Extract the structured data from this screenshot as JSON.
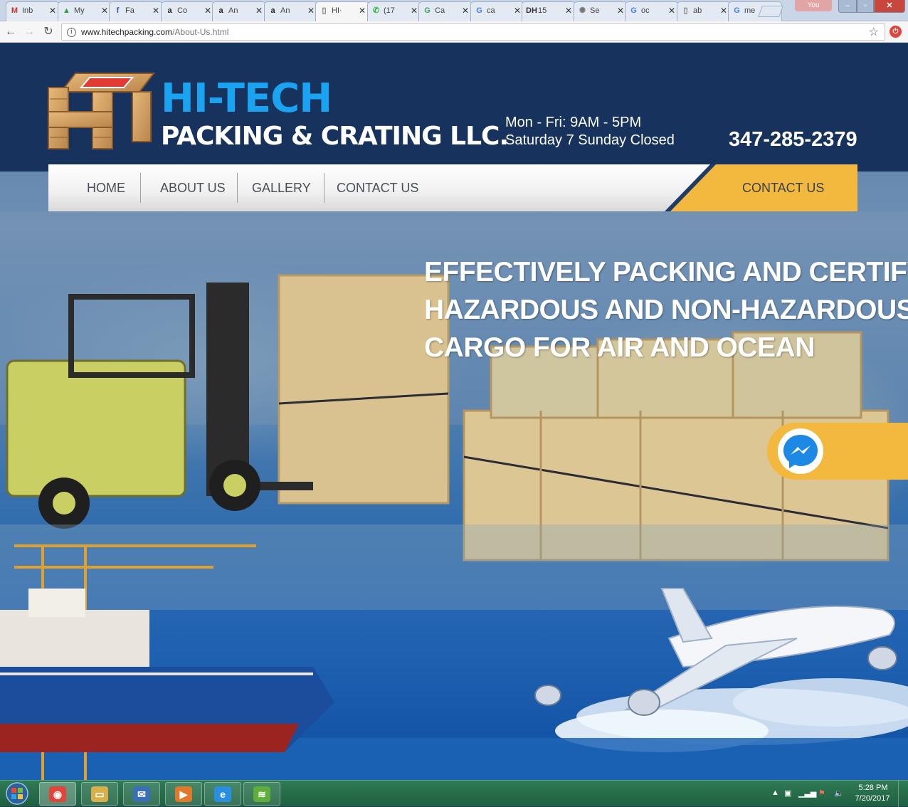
{
  "browser": {
    "tabs": [
      {
        "label": "Inb",
        "icon": "gmail-icon",
        "color": "#d93025",
        "glyph": "M",
        "left": 0
      },
      {
        "label": "My",
        "icon": "google-drive-icon",
        "color": "#2f9e44",
        "glyph": "▲",
        "left": 0
      },
      {
        "label": "Fa",
        "icon": "facebook-icon",
        "color": "#3b5998",
        "glyph": "f",
        "left": 0
      },
      {
        "label": "Co",
        "icon": "amazon-icon",
        "color": "#222222",
        "glyph": "a",
        "left": 0
      },
      {
        "label": "An",
        "icon": "amazon-icon",
        "color": "#222222",
        "glyph": "a",
        "left": 0
      },
      {
        "label": "An",
        "icon": "amazon-icon",
        "color": "#222222",
        "glyph": "a",
        "left": 0
      },
      {
        "label": "HI·",
        "icon": "page-icon",
        "color": "#777777",
        "glyph": "▯",
        "active": true
      },
      {
        "label": "(17",
        "icon": "whatsapp-icon",
        "color": "#2fb344",
        "glyph": "✆"
      },
      {
        "label": "Ca",
        "icon": "google-calendar-icon",
        "color": "#3aa55d",
        "glyph": "G"
      },
      {
        "label": "ca",
        "icon": "google-icon",
        "color": "#4285f4",
        "glyph": "G"
      },
      {
        "label": "15",
        "icon": "dh-icon",
        "color": "#333333",
        "glyph": "DH"
      },
      {
        "label": "Se",
        "icon": "globe-icon",
        "color": "#777777",
        "glyph": "✺"
      },
      {
        "label": "oc",
        "icon": "google-icon",
        "color": "#4285f4",
        "glyph": "G"
      },
      {
        "label": "ab",
        "icon": "page-icon",
        "color": "#777777",
        "glyph": "▯"
      },
      {
        "label": "me",
        "icon": "google-icon",
        "color": "#4285f4",
        "glyph": "G"
      }
    ],
    "profile_label": "You",
    "url_host": "www.hitechpacking.com",
    "url_path": "/About-Us.html"
  },
  "site": {
    "brand_top": "HI-TECH",
    "brand_bottom": "PACKING & CRATING LLC.",
    "hours_weekday": "Mon - Fri: 9AM - 5PM",
    "hours_weekend": "Saturday 7 Sunday Closed",
    "phone": "347-285-2379",
    "nav": [
      "HOME",
      "ABOUT US",
      "GALLERY",
      "CONTACT US"
    ],
    "nav_cta": "CONTACT US",
    "hero_lines": [
      "EFFECTIVELY PACKING AND CERTIFYING",
      "HAZARDOUS AND NON-HAZARDOUS",
      "CARGO FOR AIR AND OCEAN"
    ],
    "colors": {
      "header_navy": "#17325d",
      "brand_blue": "#1aa3f0",
      "accent_yellow": "#f3b93f"
    }
  },
  "taskbar": {
    "apps": [
      {
        "name": "chrome",
        "icon": "chrome-icon",
        "color": "#e0443a",
        "glyph": "◉",
        "active": true
      },
      {
        "name": "explorer",
        "icon": "folder-icon",
        "color": "#d8b04a",
        "glyph": "▭"
      },
      {
        "name": "thunderbird",
        "icon": "thunderbird-icon",
        "color": "#3a6fb5",
        "glyph": "✉"
      },
      {
        "name": "media",
        "icon": "media-player-icon",
        "color": "#e07a2a",
        "glyph": "▶"
      },
      {
        "name": "ie",
        "icon": "internet-explorer-icon",
        "color": "#2a8fe0",
        "glyph": "e"
      },
      {
        "name": "app",
        "icon": "green-app-icon",
        "color": "#5fae3c",
        "glyph": "≋"
      }
    ],
    "time": "5:28 PM",
    "date": "7/20/2017"
  }
}
